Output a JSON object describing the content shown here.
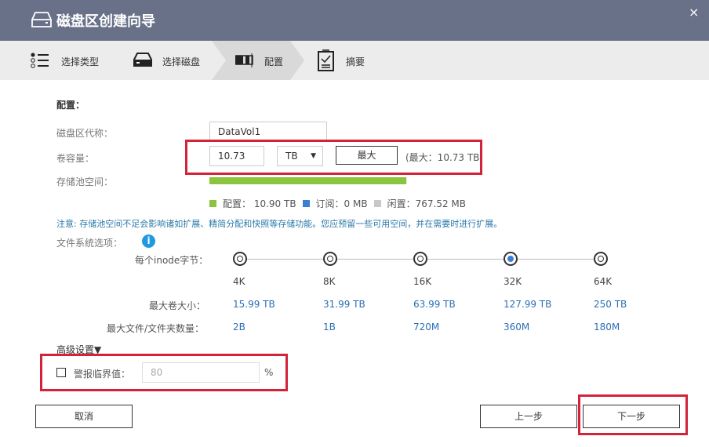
{
  "window": {
    "title": "磁盘区创建向导",
    "close": "×"
  },
  "steps": [
    {
      "label": "选择类型"
    },
    {
      "label": "选择磁盘"
    },
    {
      "label": "配置"
    },
    {
      "label": "摘要"
    }
  ],
  "config": {
    "heading": "配置：",
    "name_label": "磁盘区代称：",
    "name_value": "DataVol1",
    "capacity_label": "卷容量：",
    "capacity_value": "10.73",
    "unit": "TB",
    "max_button": "最大",
    "max_text": "(最大：10.73 TB)",
    "pool_label": "存储池空间：",
    "pool_used_fraction": 0.995,
    "legend": [
      {
        "label": "配置： 10.90 TB",
        "color": "#8cc43f"
      },
      {
        "label": "订阅：0 MB",
        "color": "#3a7fd6"
      },
      {
        "label": "闲置：767.52 MB",
        "color": "#c8c8c8"
      }
    ],
    "note": "注意: 存储池空间不足会影响诸如扩展、精简分配和快照等存储功能。您应预留一些可用空间，并在需要时进行扩展。",
    "fs_label": "文件系统选项："
  },
  "inode": {
    "label": "每个inode字节：",
    "max_vol_label": "最大卷大小：",
    "max_files_label": "最大文件/文件夹数量：",
    "options": [
      {
        "size": "4K",
        "max_vol": "15.99 TB",
        "max_files": "2B",
        "selected": false
      },
      {
        "size": "8K",
        "max_vol": "31.99 TB",
        "max_files": "1B",
        "selected": false
      },
      {
        "size": "16K",
        "max_vol": "63.99 TB",
        "max_files": "720M",
        "selected": false
      },
      {
        "size": "32K",
        "max_vol": "127.99 TB",
        "max_files": "360M",
        "selected": true
      },
      {
        "size": "64K",
        "max_vol": "250 TB",
        "max_files": "180M",
        "selected": false
      }
    ]
  },
  "advanced": {
    "toggle": "高级设置▼",
    "alert_label": "警报临界值：",
    "alert_value": "80",
    "percent": "%"
  },
  "footer": {
    "cancel": "取消",
    "prev": "上一步",
    "next": "下一步"
  }
}
